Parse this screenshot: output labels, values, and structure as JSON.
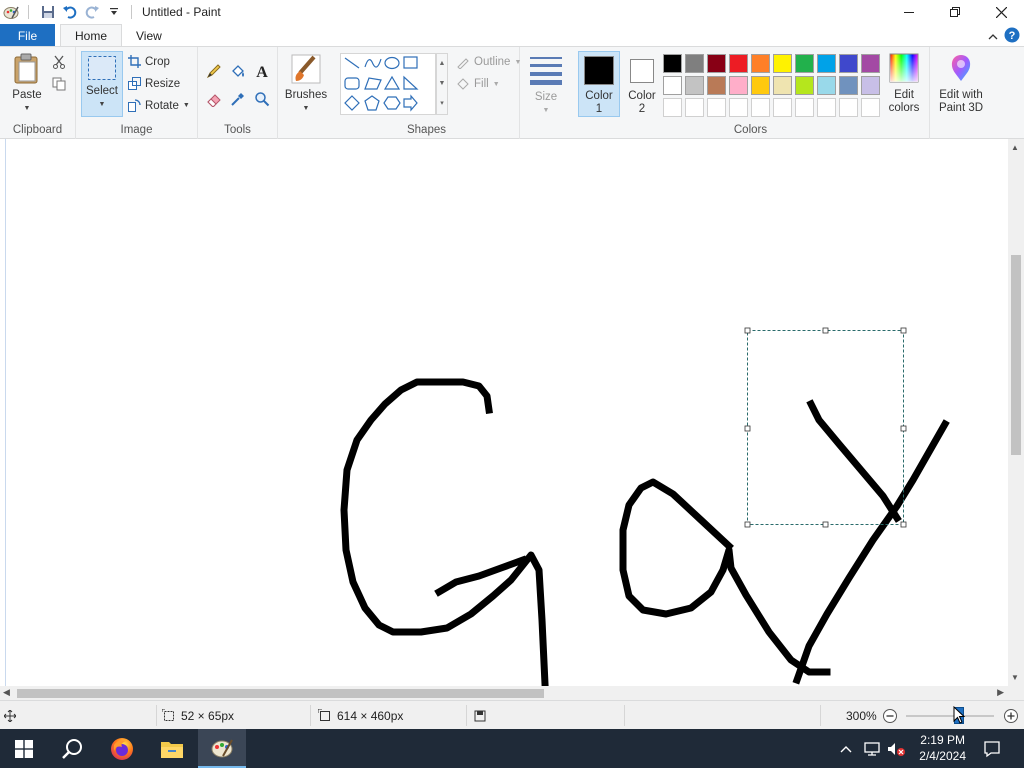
{
  "window": {
    "title": "Untitled - Paint",
    "minimize_label": "Minimize",
    "maximize_label": "Maximize",
    "close_label": "Close"
  },
  "tabs": [
    {
      "label": "File",
      "active": false
    },
    {
      "label": "Home",
      "active": true
    },
    {
      "label": "View",
      "active": false
    }
  ],
  "ribbon": {
    "clipboard": {
      "label": "Clipboard",
      "paste_label": "Paste"
    },
    "image": {
      "label": "Image",
      "select_label": "Select",
      "crop_label": "Crop",
      "resize_label": "Resize",
      "rotate_label": "Rotate"
    },
    "tools": {
      "label": "Tools"
    },
    "brushes": {
      "label": "Brushes"
    },
    "shapes": {
      "label": "Shapes",
      "outline_label": "Outline",
      "fill_label": "Fill"
    },
    "size": {
      "label": "Size"
    },
    "colors": {
      "label": "Colors",
      "color1_label": "Color",
      "color1_num": "1",
      "color2_label": "Color",
      "color2_num": "2",
      "color1_value": "#000000",
      "color2_value": "#ffffff",
      "edit_colors_line1": "Edit",
      "edit_colors_line2": "colors",
      "paint3d_line1": "Edit with",
      "paint3d_line2": "Paint 3D",
      "palette_row1": [
        "#000000",
        "#7f7f7f",
        "#880015",
        "#ed1c24",
        "#ff7f27",
        "#fff200",
        "#22b14c",
        "#00a2e8",
        "#3f48cc",
        "#a349a4"
      ],
      "palette_row2": [
        "#ffffff",
        "#c3c3c3",
        "#b97a57",
        "#ffaec9",
        "#ffc90e",
        "#efe4b0",
        "#b5e61d",
        "#99d9ea",
        "#7092be",
        "#c8bfe7"
      ]
    }
  },
  "statusbar": {
    "selection_size": "52 × 65px",
    "canvas_size": "614 × 460px",
    "zoom": "300%"
  },
  "taskbar": {
    "time": "2:19 PM",
    "date": "2/4/2024"
  }
}
